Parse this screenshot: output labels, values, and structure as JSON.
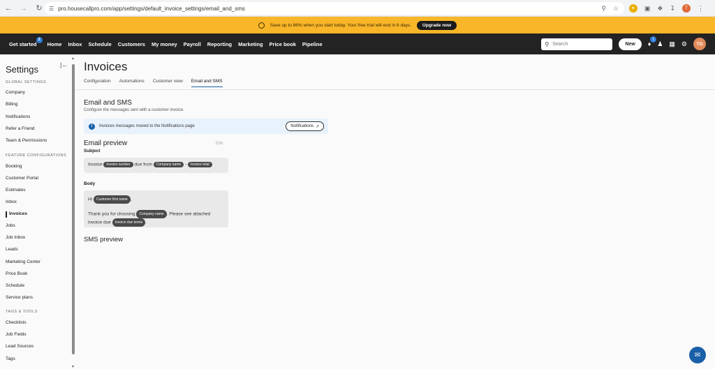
{
  "browser": {
    "url": "pro.housecallpro.com/app/settings/default_invoice_settings/email_and_sms",
    "profile_initial": "T"
  },
  "promo": {
    "text": "Save up to 86% when you start today. Your free trial will end in 6 days.",
    "button": "Upgrade now"
  },
  "nav": {
    "items": [
      "Get started",
      "Home",
      "Inbox",
      "Schedule",
      "Customers",
      "My money",
      "Payroll",
      "Reporting",
      "Marketing",
      "Price book",
      "Pipeline"
    ],
    "get_started_badge": "2",
    "search_placeholder": "Search",
    "new_button": "New",
    "notification_badge": "1",
    "avatar_initials": "TG"
  },
  "sidebar": {
    "title": "Settings",
    "global_heading": "GLOBAL SETTINGS",
    "global_items": [
      "Company",
      "Billing",
      "Notifications",
      "Refer a Friend",
      "Team & Permissions"
    ],
    "feature_heading": "FEATURE CONFIGURATIONS",
    "feature_items": [
      "Booking",
      "Customer Portal",
      "Estimates",
      "Inbox",
      "Invoices",
      "Jobs",
      "Job Inbox",
      "Leads",
      "Marketing Center",
      "Price Book",
      "Schedule",
      "Service plans"
    ],
    "tags_heading": "TAGS & TOOLS",
    "tags_items": [
      "Checklists",
      "Job Fields",
      "Lead Sources",
      "Tags"
    ]
  },
  "main": {
    "title": "Invoices",
    "tabs": [
      "Configuration",
      "Automations",
      "Customer view",
      "Email and SMS"
    ],
    "section_title": "Email and SMS",
    "section_subtitle": "Configure the messages sent with a customer invoice.",
    "info_text": "Invoices messages moved to the Notifications page",
    "info_button": "Notifications",
    "email_preview_title": "Email preview",
    "edit_label": "Edit",
    "subject_label": "Subject",
    "subject": {
      "word_invoice": "Invoice",
      "chip_invoice_number": "Invoice number",
      "word_due_from": "due from",
      "chip_company_name": "Company name",
      "separator": "-",
      "chip_invoice_total": "Invoice total"
    },
    "body_label": "Body",
    "body": {
      "hi": "Hi",
      "chip_customer_first_name": "Customer first name",
      "thank_you": "Thank you for choosing",
      "chip_company_name": "Company name",
      "see_attached": ". Please see attached",
      "invoice_due": "invoice due",
      "chip_invoice_due_terms": "Invoice due terms"
    },
    "sms_preview_title": "SMS preview"
  }
}
